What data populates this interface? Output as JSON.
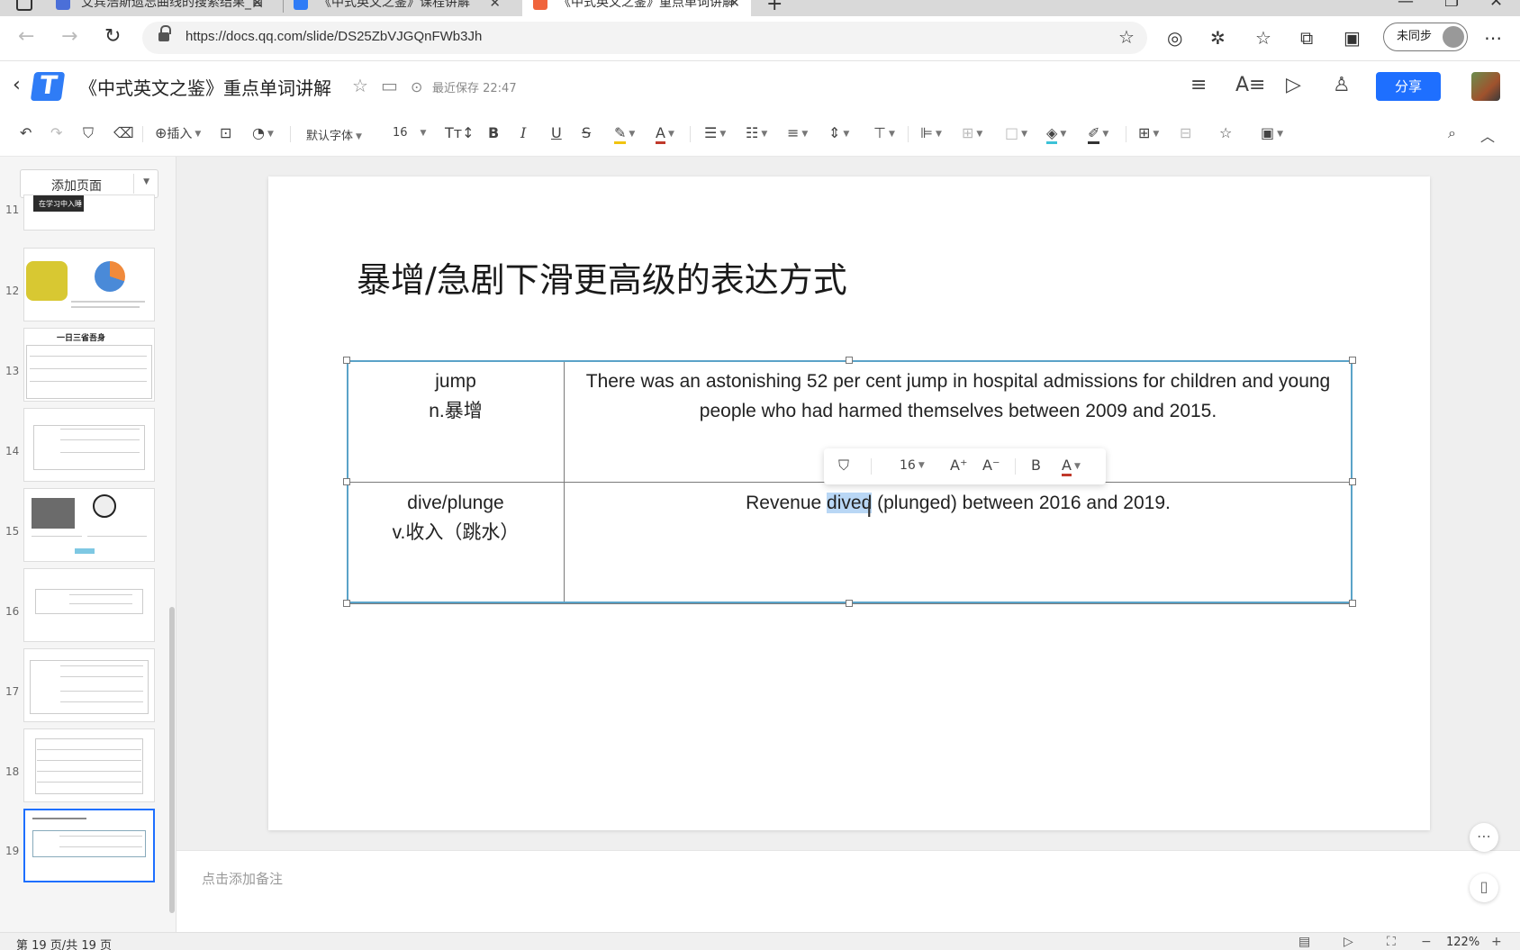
{
  "browser": {
    "tabs": [
      {
        "title": "艾宾浩斯遗忘曲线的搜索结果_百",
        "active": false,
        "color": "#4b6fd8"
      },
      {
        "title": "《中式英文之鉴》课程讲解",
        "active": false,
        "color": "#2f7cf6"
      },
      {
        "title": "《中式英文之鉴》重点单词讲解",
        "active": true,
        "color": "#f0643c"
      }
    ],
    "url": "https://docs.qq.com/slide/DS25ZbVJGQnFWb3Jh",
    "sync_label": "未同步"
  },
  "doc": {
    "title": "《中式英文之鉴》重点单词讲解",
    "save_status": "最近保存 22:47",
    "share_label": "分享"
  },
  "toolbar": {
    "insert_label": "插入",
    "font_family": "默认字体",
    "font_size": "16",
    "accent_red": "#c0392b"
  },
  "sidebar": {
    "add_page_label": "添加页面",
    "thumb_banner": "在学习中入睡",
    "thumb_heading_13": "一日三省吾身",
    "pages": [
      "11",
      "12",
      "13",
      "14",
      "15",
      "16",
      "17",
      "18",
      "19"
    ],
    "selected_page": "19"
  },
  "slide": {
    "title": "暴增/急剧下滑更高级的表达方式",
    "rows": [
      {
        "word": "jump",
        "meaning": "n.暴增",
        "example": "There was an astonishing 52 per cent jump in hospital admissions for children and young people who had harmed themselves between 2009 and 2015."
      },
      {
        "word": "dive/plunge",
        "meaning": "v.收入（跳水）",
        "example_before": "Revenue ",
        "example_selected": "dived",
        "example_after": " (plunged) between 2016 and 2019."
      }
    ]
  },
  "float_toolbar": {
    "font_size": "16",
    "bold": "B",
    "color_letter": "A"
  },
  "notes": {
    "placeholder": "点击添加备注"
  },
  "status": {
    "page_info": "第 19 页/共 19 页",
    "zoom": "122%"
  }
}
